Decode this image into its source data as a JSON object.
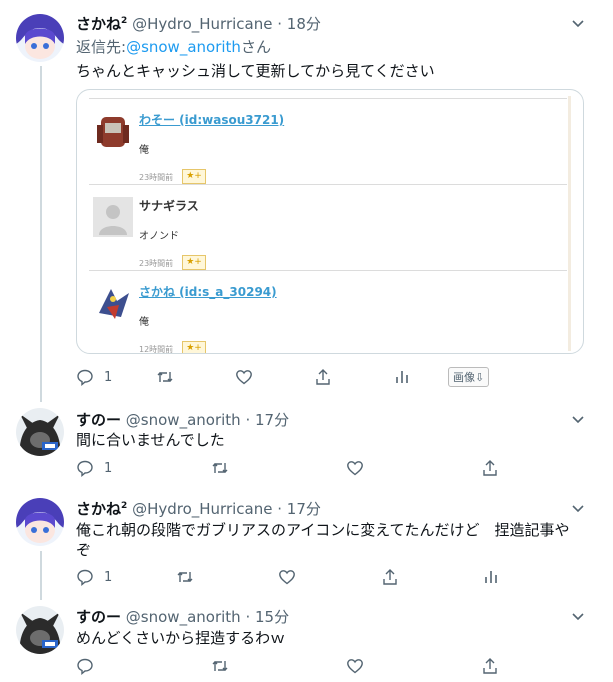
{
  "tweets": [
    {
      "name": "さかね",
      "sup": "2",
      "handle": "@Hydro_Hurricane",
      "time": "18分",
      "reply_prefix": "返信先:",
      "reply_mention": "@snow_anorith",
      "reply_suffix": "さん",
      "text": "ちゃんとキャッシュ消して更新してから見てください",
      "reply_count": "1",
      "image_button": "画像⇩"
    },
    {
      "name": "すのー",
      "handle": "@snow_anorith",
      "time": "17分",
      "text": "間に合いませんでした",
      "reply_count": "1"
    },
    {
      "name": "さかね",
      "sup": "2",
      "handle": "@Hydro_Hurricane",
      "time": "17分",
      "text": "俺これ朝の段階でガブリアスのアイコンに変えてたんだけど　捏造記事やぞ",
      "reply_count": "1"
    },
    {
      "name": "すのー",
      "handle": "@snow_anorith",
      "time": "15分",
      "text": "めんどくさいから捏造するわｗ"
    }
  ],
  "embed": {
    "entries": [
      {
        "user": "わそー (id:wasou3721)",
        "text": "俺",
        "time": "23時間前",
        "star": "★+"
      },
      {
        "user": "サナギラス",
        "text": "オノンド",
        "time": "23時間前",
        "star": "★+"
      },
      {
        "user": "さかね (id:s_a_30294)",
        "text": "俺",
        "time": "12時間前",
        "star": "★+"
      }
    ]
  },
  "dot": "·",
  "colors": {
    "link": "#1d9bf0",
    "muted": "#536471",
    "thread_line": "#cfd9de"
  },
  "icons": [
    "reply-icon",
    "retweet-icon",
    "like-icon",
    "share-icon",
    "analytics-icon",
    "chevron-down-icon"
  ]
}
